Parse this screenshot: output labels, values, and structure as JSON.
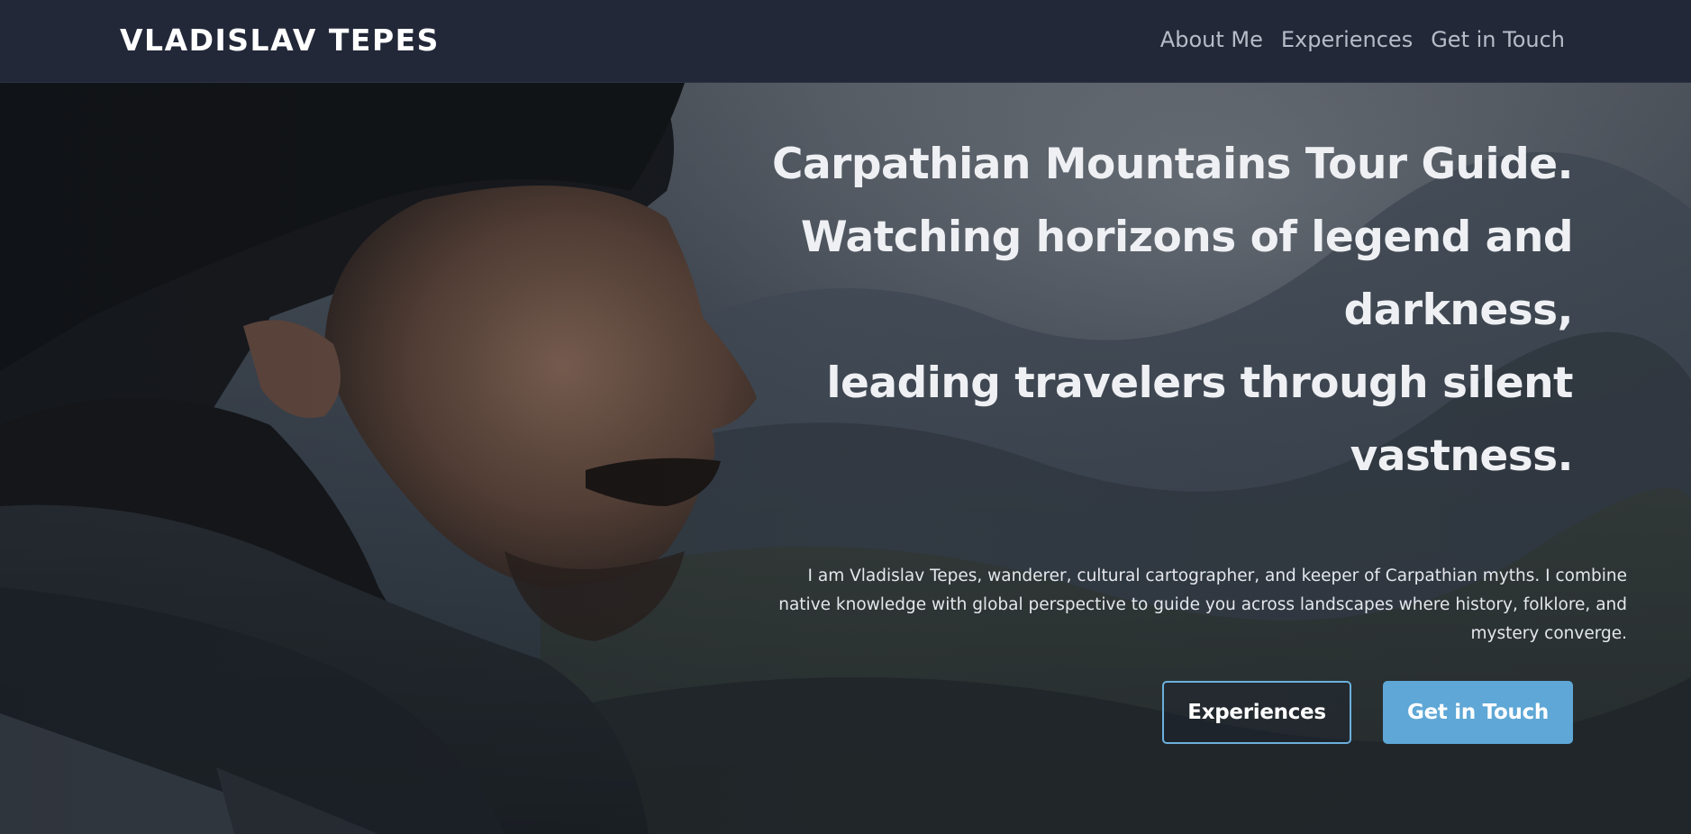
{
  "header": {
    "brand": "VLADISLAV TEPES",
    "nav": [
      {
        "label": "About Me"
      },
      {
        "label": "Experiences"
      },
      {
        "label": "Get in Touch"
      }
    ]
  },
  "hero": {
    "headline": [
      "Carpathian Mountains Tour Guide.",
      "Watching horizons of legend and",
      "darkness,",
      "leading travelers through silent",
      "vastness."
    ],
    "bio": "I am Vladislav Tepes, wanderer, cultural cartographer, and keeper of Carpathian myths. I combine native knowledge with global perspective to guide you across landscapes where history, folklore, and mystery converge.",
    "buttons": {
      "experiences": "Experiences",
      "contact": "Get in Touch"
    }
  },
  "colors": {
    "nav_background": "#222838",
    "accent": "#5ea7d6",
    "headline_text": "#eef0f3"
  }
}
